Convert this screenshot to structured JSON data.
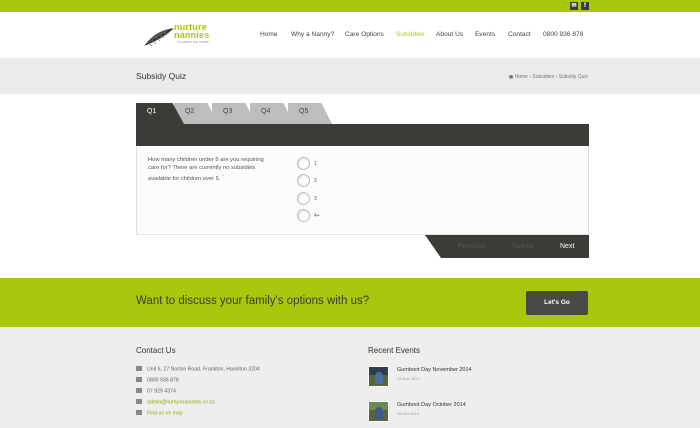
{
  "topbar": {
    "social": [
      {
        "name": "email-icon",
        "glyph": "✉"
      },
      {
        "name": "facebook-icon",
        "glyph": "f"
      }
    ]
  },
  "logo": {
    "text_line1": "nurture",
    "text_line2": "nannies",
    "tagline": "in place we make"
  },
  "nav": {
    "items": [
      {
        "label": "Home",
        "active": false
      },
      {
        "label": "Why a Nanny?",
        "active": false
      },
      {
        "label": "Care Options",
        "active": false
      },
      {
        "label": "Subsidies",
        "active": true
      },
      {
        "label": "About Us",
        "active": false
      },
      {
        "label": "Events",
        "active": false
      },
      {
        "label": "Contact",
        "active": false
      }
    ],
    "phone": "0800 936 878"
  },
  "titlebar": {
    "title": "Subsidy Quiz",
    "breadcrumb": [
      "Home",
      "Subsidies",
      "Subsidy Quiz"
    ],
    "breadcrumb_sep": "›"
  },
  "quiz": {
    "tabs": [
      {
        "label": "Q1",
        "active": true
      },
      {
        "label": "Q2",
        "active": false
      },
      {
        "label": "Q3",
        "active": false
      },
      {
        "label": "Q4",
        "active": false
      },
      {
        "label": "Q5",
        "active": false
      }
    ],
    "question": "How many children under 5 are you requiring care for? There are currently no subsidies available for children over 5.",
    "question_marker": "^",
    "options": [
      "1",
      "2",
      "3",
      "4+"
    ],
    "buttons": {
      "previous": "Previous",
      "submit": "Submit",
      "next": "Next"
    }
  },
  "cta": {
    "text": "Want to discuss your family's options with us?",
    "button": "Let's Go"
  },
  "footer": {
    "contact": {
      "heading": "Contact Us",
      "address": "Unit 6, 27 Norton Road, Frankton, Hamilton 3204",
      "phone1": "0800 936 878",
      "phone2": "07 929 4374",
      "email": "admin@nurturenannies.co.nz",
      "map_link": "Find us on map"
    },
    "events": {
      "heading": "Recent Events",
      "items": [
        {
          "title": "Gumboot Day November 2014",
          "date": "13 Nov 2014"
        },
        {
          "title": "Gumboot Day October 2014",
          "date": "09 Oct 2014"
        }
      ]
    }
  },
  "colors": {
    "accent": "#a9c80d",
    "dark": "#3b3b38",
    "title_bg": "#ebebeb"
  }
}
